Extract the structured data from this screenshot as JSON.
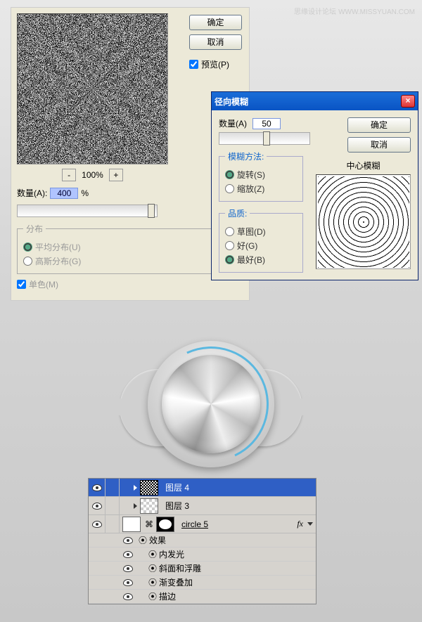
{
  "watermark": {
    "site": "思缘设计论坛",
    "url": "WWW.MISSYUAN.COM"
  },
  "noise_dialog": {
    "ok": "确定",
    "cancel": "取消",
    "preview_label": "预览(P)",
    "zoom_pct": "100%",
    "amount_label": "数量(A):",
    "amount_value": "400",
    "pct": "%",
    "distribution_legend": "分布",
    "uniform": "平均分布(U)",
    "gaussian": "高斯分布(G)",
    "mono": "单色(M)"
  },
  "radial_dialog": {
    "title": "径向模糊",
    "ok": "确定",
    "cancel": "取消",
    "amount_label": "数量(A)",
    "amount_value": "50",
    "method_legend": "模糊方法:",
    "spin": "旋转(S)",
    "zoom": "缩放(Z)",
    "quality_legend": "品质:",
    "draft": "草图(D)",
    "good": "好(G)",
    "best": "最好(B)",
    "center_label": "中心模糊"
  },
  "layers": {
    "l4": "图层 4",
    "l3": "图层 3",
    "circle5": "circle 5",
    "fx": "fx",
    "effects": "效果",
    "inner_glow": "内发光",
    "bevel": "斜面和浮雕",
    "grad_overlay": "渐变叠加",
    "stroke": "描边"
  }
}
